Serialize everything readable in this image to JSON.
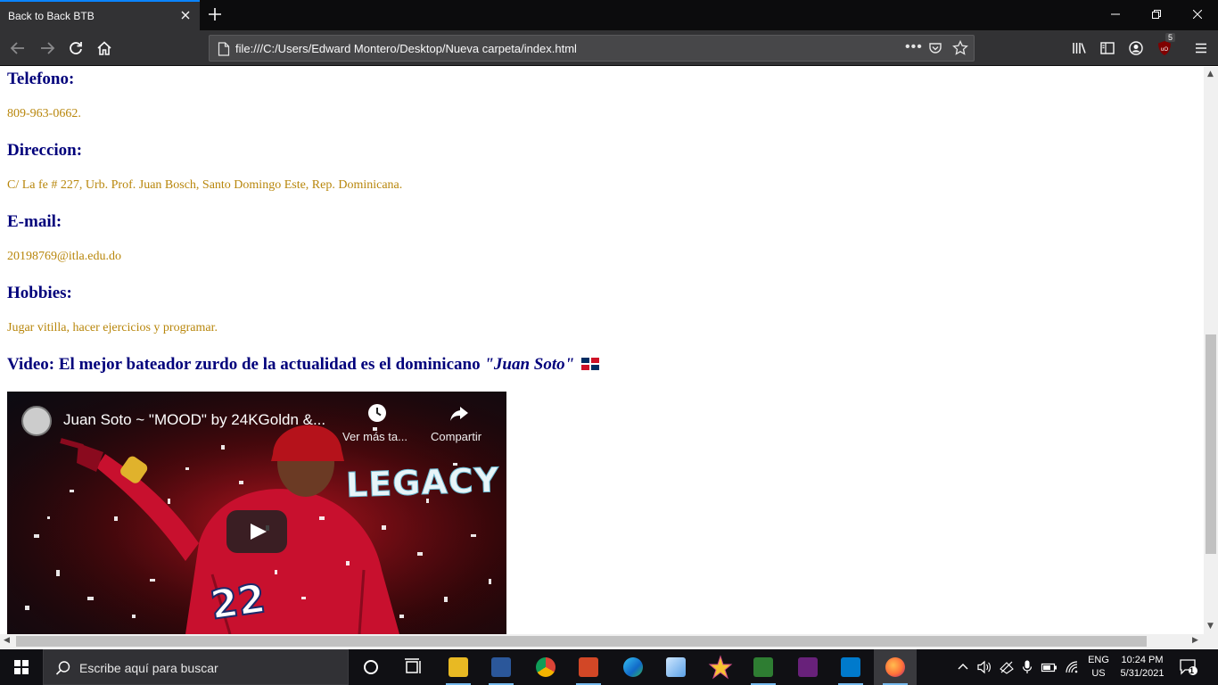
{
  "browser": {
    "tab_title": "Back to Back BTB",
    "url": "file:///C:/Users/Edward Montero/Desktop/Nueva carpeta/index.html",
    "url_actions": "•••",
    "extension_badge": "5"
  },
  "page": {
    "sections": [
      {
        "heading": "Telefono:",
        "text": "809-963-0662."
      },
      {
        "heading": "Direccion:",
        "text": "C/ La fe # 227, Urb. Prof. Juan Bosch, Santo Domingo Este, Rep. Dominicana."
      },
      {
        "heading": "E-mail:",
        "text": "20198769@itla.edu.do"
      },
      {
        "heading": "Hobbies:",
        "text": "Jugar vitilla, hacer ejercicios y programar."
      }
    ],
    "video_heading": {
      "prefix": "Video: El mejor bateador zurdo de la actualidad es el dominicano ",
      "emphasis": "\"Juan Soto\""
    },
    "video": {
      "title": "Juan Soto ~ \"MOOD\" by 24KGoldn &...",
      "watch_later": "Ver más ta...",
      "share": "Compartir",
      "overlay_text": "LEGACY",
      "jersey_number": "22"
    }
  },
  "taskbar": {
    "search_placeholder": "Escribe aquí para buscar",
    "language": [
      "ENG",
      "US"
    ],
    "time": "10:24 PM",
    "date": "5/31/2021",
    "notification_count": "1"
  },
  "colors": {
    "heading": "#00007b",
    "body_text": "#b8860b",
    "chrome_dark": "#0c0c0d",
    "chrome_toolbar": "#323234",
    "accent": "#0a84ff"
  }
}
